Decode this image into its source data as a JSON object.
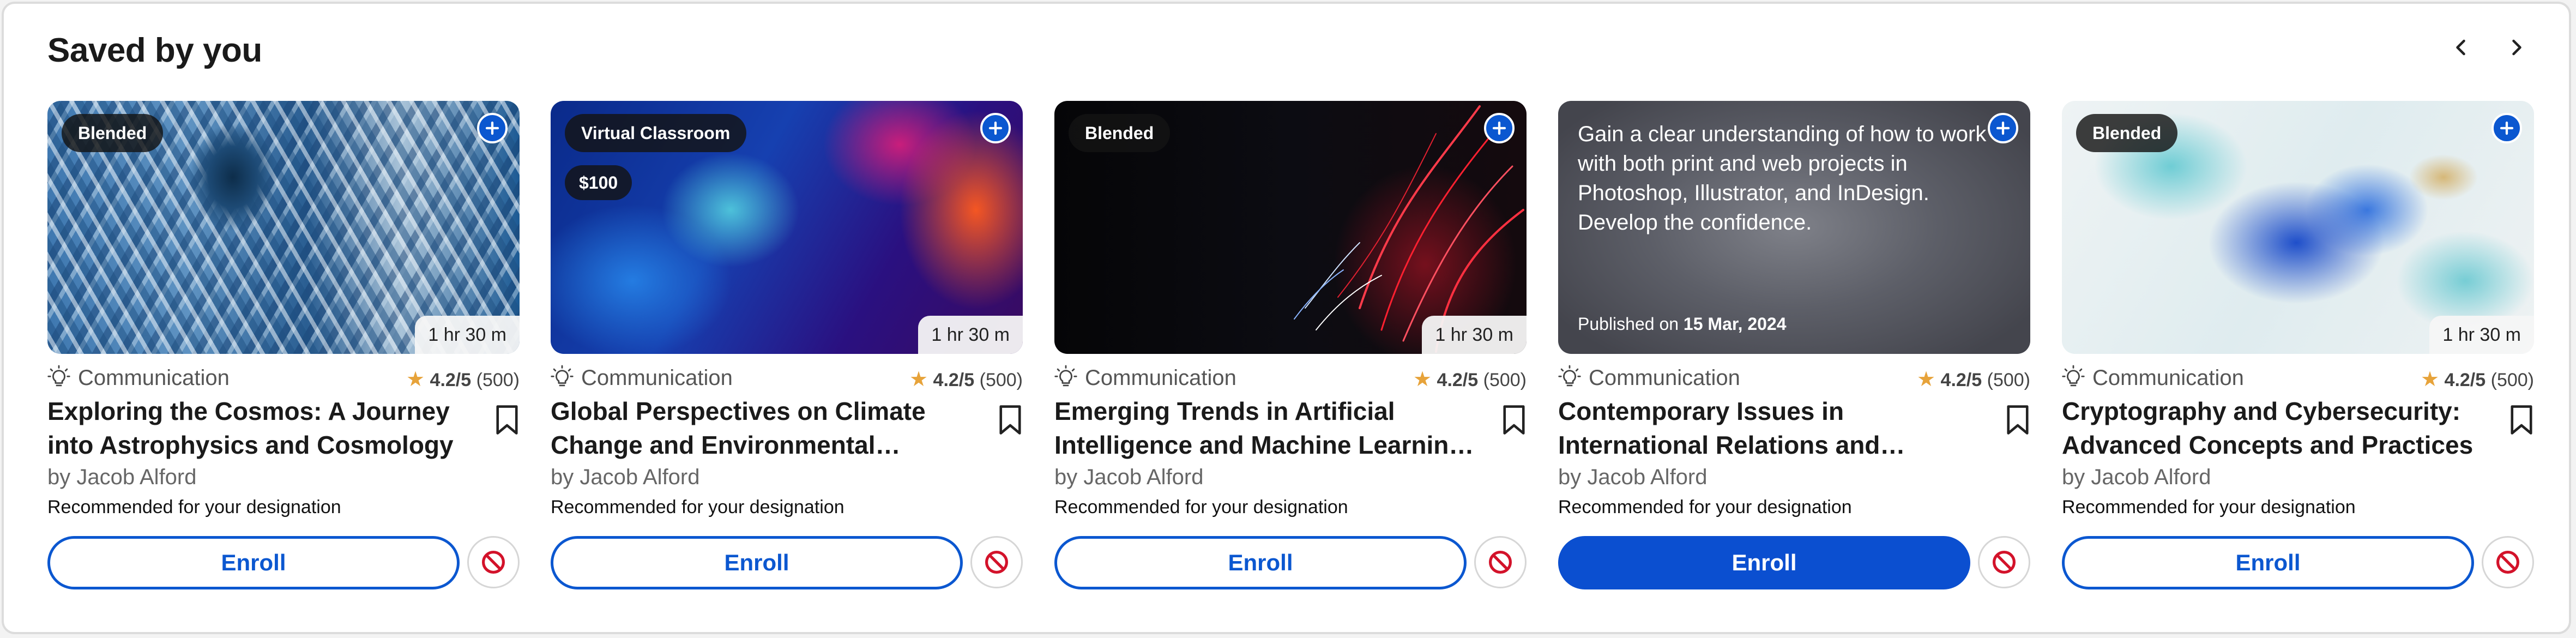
{
  "section": {
    "title": "Saved by you"
  },
  "cards": [
    {
      "type_badge": "Blended",
      "price": "",
      "duration": "1 hr 30 m",
      "description": "",
      "published_label": "",
      "published_date": "",
      "category": "Communication",
      "rating": "4.2/5",
      "reviews": "(500)",
      "title": "Exploring the Cosmos: A Journey into Astrophysics and Cosmology",
      "author": "by Jacob Alford",
      "recommendation": "Recommended for your designation",
      "enroll_label": "Enroll"
    },
    {
      "type_badge": "Virtual Classroom",
      "price": "$100",
      "duration": "1 hr 30 m",
      "description": "",
      "published_label": "",
      "published_date": "",
      "category": "Communication",
      "rating": "4.2/5",
      "reviews": "(500)",
      "title": "Global Perspectives on Climate Change and Environmental Sustainability",
      "author": "by Jacob Alford",
      "recommendation": "Recommended for your designation",
      "enroll_label": "Enroll"
    },
    {
      "type_badge": "Blended",
      "price": "",
      "duration": "1 hr 30 m",
      "description": "",
      "published_label": "",
      "published_date": "",
      "category": "Communication",
      "rating": "4.2/5",
      "reviews": "(500)",
      "title": "Emerging Trends in Artificial Intelligence and Machine Learning Applications",
      "author": "by Jacob Alford",
      "recommendation": "Recommended for your designation",
      "enroll_label": "Enroll"
    },
    {
      "type_badge": "",
      "price": "",
      "duration": "",
      "description": "Gain a clear understanding of how to work with both print and web projects in Photoshop, Illustrator, and InDesign. Develop the confidence.",
      "published_label": "Published on",
      "published_date": "15 Mar, 2024",
      "category": "Communication",
      "rating": "4.2/5",
      "reviews": "(500)",
      "title": "Contemporary Issues in International Relations and Diplomacy",
      "author": "by Jacob Alford",
      "recommendation": "Recommended for your designation",
      "enroll_label": "Enroll"
    },
    {
      "type_badge": "Blended",
      "price": "",
      "duration": "1 hr 30 m",
      "description": "",
      "published_label": "",
      "published_date": "",
      "category": "Communication",
      "rating": "4.2/5",
      "reviews": "(500)",
      "title": "Cryptography and Cybersecurity: Advanced Concepts and Practices",
      "author": "by Jacob Alford",
      "recommendation": "Recommended for your designation",
      "enroll_label": "Enroll"
    }
  ],
  "colors": {
    "accent": "#0b57d0",
    "star": "#e7a33a",
    "block_icon": "#d3122a"
  },
  "icons": {
    "nav_prev": "chevron-left-icon",
    "nav_next": "chevron-right-icon",
    "add": "plus-circle-icon",
    "category": "lightbulb-icon",
    "bookmark": "bookmark-icon",
    "not_interested": "block-icon"
  }
}
